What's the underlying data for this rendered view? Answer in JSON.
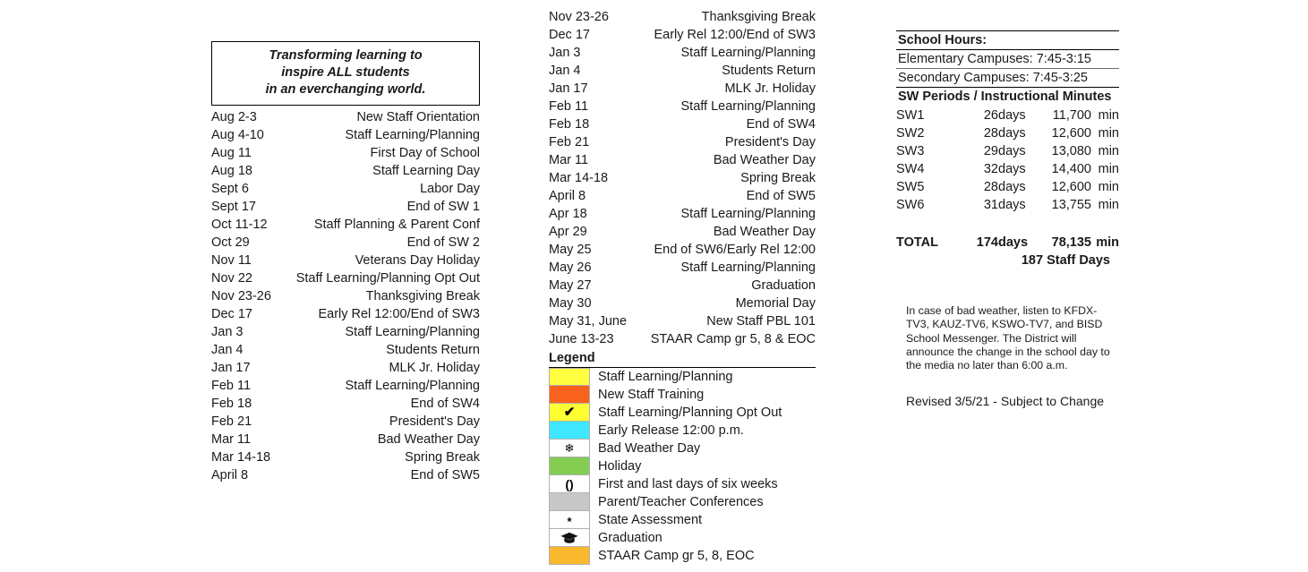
{
  "mission": {
    "lines": [
      "Transforming learning to",
      "inspire ALL students",
      "in an everchanging world."
    ]
  },
  "left_column": {
    "rows": [
      {
        "date": "Aug 2-3",
        "event": "New Staff Orientation"
      },
      {
        "date": "Aug 4-10",
        "event": "Staff Learning/Planning"
      },
      {
        "date": "Aug 11",
        "event": "First Day of School"
      },
      {
        "date": "Aug 18",
        "event": "Staff Learning Day"
      },
      {
        "date": "Sept 6",
        "event": "Labor Day"
      },
      {
        "date": "Sept 17",
        "event": "End of SW 1"
      },
      {
        "date": "Oct 11-12",
        "event": "Staff Planning & Parent Conf"
      },
      {
        "date": "Oct 29",
        "event": "End of SW 2"
      },
      {
        "date": "Nov 11",
        "event": "Veterans Day Holiday"
      },
      {
        "date": "Nov 22",
        "event": "Staff Learning/Planning Opt Out"
      },
      {
        "date": "Nov 23-26",
        "event": "Thanksgiving Break"
      },
      {
        "date": "Dec 17",
        "event": "Early Rel 12:00/End of SW3"
      },
      {
        "date": "Jan 3",
        "event": "Staff Learning/Planning"
      },
      {
        "date": "Jan 4",
        "event": "Students Return"
      },
      {
        "date": "Jan 17",
        "event": "MLK Jr. Holiday"
      },
      {
        "date": "Feb 11",
        "event": "Staff Learning/Planning"
      },
      {
        "date": "Feb 18",
        "event": "End of SW4"
      },
      {
        "date": "Feb 21",
        "event": "President's Day"
      },
      {
        "date": "Mar 11",
        "event": "Bad Weather Day"
      },
      {
        "date": "Mar 14-18",
        "event": "Spring Break"
      },
      {
        "date": "April 8",
        "event": "End of SW5"
      }
    ]
  },
  "middle_column": {
    "rows": [
      {
        "date": "Nov 23-26",
        "event": "Thanksgiving Break"
      },
      {
        "date": "Dec 17",
        "event": "Early Rel 12:00/End of SW3"
      },
      {
        "date": "Jan 3",
        "event": "Staff Learning/Planning"
      },
      {
        "date": "Jan 4",
        "event": "Students Return"
      },
      {
        "date": "Jan 17",
        "event": "MLK Jr. Holiday"
      },
      {
        "date": "Feb 11",
        "event": "Staff Learning/Planning"
      },
      {
        "date": "Feb 18",
        "event": "End of SW4"
      },
      {
        "date": "Feb 21",
        "event": "President's Day"
      },
      {
        "date": "Mar 11",
        "event": "Bad Weather Day"
      },
      {
        "date": "Mar 14-18",
        "event": "Spring Break"
      },
      {
        "date": "April 8",
        "event": "End of SW5"
      },
      {
        "date": "Apr 18",
        "event": "Staff Learning/Planning"
      },
      {
        "date": "Apr 29",
        "event": "Bad Weather Day"
      },
      {
        "date": "May 25",
        "event": "End of SW6/Early Rel 12:00"
      },
      {
        "date": "May 26",
        "event": "Staff Learning/Planning"
      },
      {
        "date": "May 27",
        "event": "Graduation"
      },
      {
        "date": "May 30",
        "event": "Memorial Day"
      },
      {
        "date": "May 31, June",
        "event": "New Staff PBL 101"
      },
      {
        "date": "June 13-23",
        "event": "STAAR Camp gr 5, 8 & EOC"
      }
    ]
  },
  "legend": {
    "title": "Legend",
    "items": [
      {
        "label": "Staff Learning/Planning",
        "color": "#FFFF40",
        "glyph": "",
        "glyph_name": "none"
      },
      {
        "label": "New Staff Training",
        "color": "#F8621C",
        "glyph": "",
        "glyph_name": "none"
      },
      {
        "label": "Staff Learning/Planning Opt Out",
        "color": "#FFFF33",
        "glyph": "✔",
        "glyph_name": "checkmark-icon"
      },
      {
        "label": "Early Release 12:00 p.m.",
        "color": "#3FE8FF",
        "glyph": "",
        "glyph_name": "none"
      },
      {
        "label": "Bad Weather Day",
        "color": "#FFFFFF",
        "glyph": "❄",
        "glyph_name": "snowflake-icon"
      },
      {
        "label": "Holiday",
        "color": "#84CC52",
        "glyph": "",
        "glyph_name": "none"
      },
      {
        "label": "First and last days of six weeks",
        "color": "#FFFFFF",
        "glyph": "()",
        "glyph_name": "parentheses-icon"
      },
      {
        "label": "Parent/Teacher Conferences",
        "color": "#C8C8C8",
        "glyph": "",
        "glyph_name": "none"
      },
      {
        "label": "State Assessment",
        "color": "#FFFFFF",
        "glyph": "*",
        "glyph_name": "asterisk-icon"
      },
      {
        "label": "Graduation",
        "color": "#FFFFFF",
        "glyph": "cap",
        "glyph_name": "graduation-cap-icon"
      },
      {
        "label": "STAAR Camp gr 5, 8, EOC",
        "color": "#FAB82E",
        "glyph": "",
        "glyph_name": "none"
      }
    ]
  },
  "school_hours": {
    "heading": "School Hours:",
    "elementary": "Elementary Campuses: 7:45-3:15",
    "secondary": "Secondary Campuses: 7:45-3:25",
    "sw_heading": "SW Periods / Instructional Minutes",
    "rows": [
      {
        "name": "SW1",
        "days": "26",
        "days_label": "days",
        "minutes": "11,700",
        "min_label": "min"
      },
      {
        "name": "SW2",
        "days": "28",
        "days_label": "days",
        "minutes": "12,600",
        "min_label": "min"
      },
      {
        "name": "SW3",
        "days": "29",
        "days_label": "days",
        "minutes": "13,080",
        "min_label": "min"
      },
      {
        "name": "SW4",
        "days": "32",
        "days_label": "days",
        "minutes": "14,400",
        "min_label": "min"
      },
      {
        "name": "SW5",
        "days": "28",
        "days_label": "days",
        "minutes": "12,600",
        "min_label": "min"
      },
      {
        "name": "SW6",
        "days": "31",
        "days_label": "days",
        "minutes": "13,755",
        "min_label": "min"
      }
    ],
    "total": {
      "name": "TOTAL",
      "days": "174",
      "days_label": "days",
      "minutes": "78,135",
      "min_label": "min"
    },
    "staff_days": "187 Staff Days"
  },
  "notes": {
    "bad_weather": "In case of bad weather, listen to KFDX-TV3, KAUZ-TV6, KSWO-TV7, and BISD School Messenger. The District will announce the change in the school day to the media no later than 6:00 a.m.",
    "revised": "Revised 3/5/21 - Subject to Change"
  }
}
